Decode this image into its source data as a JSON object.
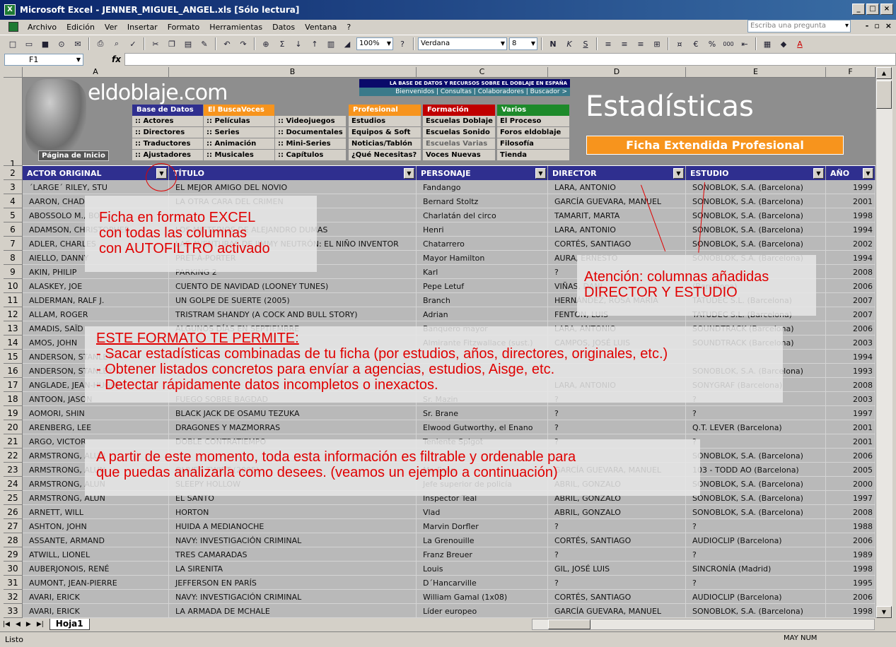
{
  "window": {
    "title": "Microsoft Excel - JENNER_MIGUEL_ANGEL.xls  [Sólo lectura]"
  },
  "menu": [
    "Archivo",
    "Edición",
    "Ver",
    "Insertar",
    "Formato",
    "Herramientas",
    "Datos",
    "Ventana",
    "?"
  ],
  "ask_placeholder": "Escriba una pregunta",
  "toolbar": {
    "zoom": "100%",
    "font": "Verdana",
    "size": "8"
  },
  "formula": {
    "namebox": "F1",
    "fx": "fx"
  },
  "columns": [
    "A",
    "B",
    "C",
    "D",
    "E",
    "F"
  ],
  "banner": {
    "logo": "eldoblaje.com",
    "tagline": "LA BASE DE DATOS Y RECURSOS SOBRE EL DOBLAJE EN ESPAÑA",
    "topnav": "Bienvenidos | Consultas | Colaboradores | Buscador >",
    "home": "Página de Inicio",
    "estadisticas": "Estadísticas",
    "ficha": "Ficha Extendida Profesional",
    "nav": [
      {
        "header": "Base de Datos",
        "color": "#2f2f8f",
        "items": [
          ":: Actores",
          ":: Directores",
          ":: Traductores",
          ":: Ajustadores"
        ]
      },
      {
        "header": "El BuscaVoces",
        "color": "#f7941d",
        "items": [
          ":: Películas",
          ":: Series",
          ":: Animación",
          ":: Musicales"
        ]
      },
      {
        "header": "",
        "color": "#8e8e8e",
        "items": [
          ":: Videojuegos",
          ":: Documentales",
          ":: Mini-Series",
          ":: Capítulos"
        ]
      },
      {
        "header": "Profesional",
        "color": "#f7941d",
        "items": [
          "Estudios",
          "Equipos & Soft",
          "Noticias/Tablón",
          "¿Qué Necesitas?"
        ]
      },
      {
        "header": "Formación",
        "color": "#c00000",
        "items": [
          "Escuelas Doblaje",
          "Escuelas Sonido",
          "Escuelas Varias",
          "Voces Nuevas"
        ]
      },
      {
        "header": "Varios",
        "color": "#1d8a2a",
        "items": [
          "El Proceso",
          "Foros eldoblaje",
          "Filosofía",
          "Tienda"
        ]
      }
    ]
  },
  "headers": [
    "ACTOR ORIGINAL",
    "TÍTULO",
    "PERSONAJE",
    "DIRECTOR",
    "ESTUDIO",
    "AÑO"
  ],
  "rows": [
    [
      "´LARGE´ RILEY, STU",
      "EL MEJOR AMIGO DEL NOVIO",
      "Fandango",
      "LARA, ANTONIO",
      "SONOBLOK, S.A. (Barcelona)",
      "1999"
    ],
    [
      "AARON, CHAD",
      "LA OTRA CARA DEL CRIMEN",
      "Bernard Stoltz",
      "GARCÍA GUEVARA, MANUEL",
      "SONOBLOK, S.A. (Barcelona)",
      "2001"
    ],
    [
      "ABOSSOLO M., BO",
      "",
      "Charlatán del circo",
      "TAMARIT, MARTA",
      "SONOBLOK, S.A. (Barcelona)",
      "1998"
    ],
    [
      "ADAMSON, CHRISTOPHER",
      "LOS MISTERIOS DE ALEJANDRO DUMAS",
      "Henri",
      "LARA, ANTONIO",
      "SONOBLOK, S.A. (Barcelona)",
      "1994"
    ],
    [
      "ADLER, CHARLES",
      "LAS AVENTURAS DE JIMMY NEUTRÓN: EL NIÑO INVENTOR",
      "Chatarrero",
      "CORTÉS, SANTIAGO",
      "SONOBLOK, S.A. (Barcelona)",
      "2002"
    ],
    [
      "AIELLO, DANNY",
      "PRÊT-À-PORTER",
      "Mayor Hamilton",
      "AURA, ERNESTO",
      "SONOBLOK, S.A. (Barcelona)",
      "1994"
    ],
    [
      "AKIN, PHILIP",
      "PARKING 2",
      "Karl",
      "?",
      "",
      "2008"
    ],
    [
      "ALASKEY, JOE",
      "CUENTO DE NAVIDAD (LOONEY TUNES)",
      "Pepe Letuf",
      "VIÑAS, DANI",
      "(Barcelona)",
      "2006"
    ],
    [
      "ALDERMAN, RALF J.",
      "UN GOLPE DE SUERTE (2005)",
      "Branch",
      "HERNÁNDEZ, ROSA MARÍA",
      "TATUDEC S.L. (Barcelona)",
      "2007"
    ],
    [
      "ALLAM, ROGER",
      "TRISTRAM SHANDY (A COCK AND BULL STORY)",
      "Adrian",
      "FENTON, LUIS",
      "TATUDEC S.L. (Barcelona)",
      "2007"
    ],
    [
      "AMADIS, SAÏD",
      "ALGUNOS DÍAS EN SEPTIEMBRE",
      "Banquero mayor",
      "LARA, ANTONIO",
      "SOUNDTRACK (Barcelona)",
      "2006"
    ],
    [
      "AMOS, JOHN",
      "",
      "Almirante Fitzwallace (sust.)",
      "CAMPOS, JOSÉ LUIS",
      "SOUNDTRACK (Barcelona)",
      "2003"
    ],
    [
      "ANDERSON, STANLEY",
      "",
      "",
      "",
      "",
      "1994"
    ],
    [
      "ANDERSON, STANLEY",
      "",
      "",
      "",
      "SONOBLOK, S.A. (Barcelona)",
      "1993"
    ],
    [
      "ANGLADE, JEAN-HUGUES",
      "",
      "",
      "LARA, ANTONIO",
      "SONYGRAF (Barcelona)",
      "2008"
    ],
    [
      "ANTOON, JASON",
      "FUEGO SOBRE BAGDAD",
      "Sr. Mazin",
      "?",
      "?",
      "2003"
    ],
    [
      "AOMORI, SHIN",
      "BLACK JACK DE OSAMU TEZUKA",
      "Sr. Brane",
      "?",
      "?",
      "1997"
    ],
    [
      "ARENBERG, LEE",
      "DRAGONES Y MAZMORRAS",
      "Elwood Gutworthy, el Enano",
      "?",
      "Q.T. LEVER (Barcelona)",
      "2001"
    ],
    [
      "ARGO, VICTOR",
      "DOBLE CONTRATIEMPO",
      "Teniente Spigot",
      "?",
      "?",
      "2001"
    ],
    [
      "ARMSTRONG, ALUN",
      "",
      "",
      "",
      "SONOBLOK, S.A. (Barcelona)",
      "2006"
    ],
    [
      "ARMSTRONG, ALUN",
      "OLIVER TWIST (2005)",
      "Mr. Fang",
      "GARCÍA GUEVARA, MANUEL",
      "103 - TODD AO (Barcelona)",
      "2005"
    ],
    [
      "ARMSTRONG, ALUN",
      "SLEEPY HOLLOW",
      "Jefe superior de policía",
      "ABRIL, GONZALO",
      "SONOBLOK, S.A. (Barcelona)",
      "2000"
    ],
    [
      "ARMSTRONG, ALUN",
      "EL SANTO",
      "Inspector Teal",
      "ABRIL, GONZALO",
      "SONOBLOK, S.A. (Barcelona)",
      "1997"
    ],
    [
      "ARNETT, WILL",
      "HORTON",
      "Vlad",
      "ABRIL, GONZALO",
      "SONOBLOK, S.A. (Barcelona)",
      "2008"
    ],
    [
      "ASHTON, JOHN",
      "HUIDA A MEDIANOCHE",
      "Marvin Dorfler",
      "?",
      "?",
      "1988"
    ],
    [
      "ASSANTE, ARMAND",
      "NAVY: INVESTIGACIÓN CRIMINAL",
      "La Grenouille",
      "CORTÉS, SANTIAGO",
      "AUDIOCLIP (Barcelona)",
      "2006"
    ],
    [
      "ATWILL, LIONEL",
      "TRES CAMARADAS",
      "Franz Breuer",
      "?",
      "?",
      "1989"
    ],
    [
      "AUBERJONOIS, RENÉ",
      "LA SIRENITA",
      "Louis",
      "GIL, JOSÉ LUIS",
      "SINCRONÍA (Madrid)",
      "1998"
    ],
    [
      "AUMONT, JEAN-PIERRE",
      "JEFFERSON EN PARÍS",
      "D´Hancarville",
      "?",
      "?",
      "1995"
    ],
    [
      "AVARI, ERICK",
      "NAVY: INVESTIGACIÓN CRIMINAL",
      "William Gamal (1x08)",
      "CORTÉS, SANTIAGO",
      "AUDIOCLIP (Barcelona)",
      "2006"
    ],
    [
      "AVARI, ERICK",
      "LA ARMADA DE MCHALE",
      "Líder europeo",
      "GARCÍA GUEVARA, MANUEL",
      "SONOBLOK, S.A. (Barcelona)",
      "1998"
    ]
  ],
  "overlays": {
    "o1": [
      "Ficha en formato EXCEL",
      "con todas las columnas",
      "con AUTOFILTRO activado"
    ],
    "o2": [
      "Atención: columnas añadidas",
      "DIRECTOR Y ESTUDIO"
    ],
    "o3": [
      "ESTE FORMATO TE PERMITE:",
      "- Sacar estadísticas combinadas de tu ficha (por estudios, años, directores, originales, etc.)",
      "- Obtener listados concretos para envíar a agencias, estudios, Aisge, etc.",
      "- Detectar rápidamente datos incompletos o inexactos."
    ],
    "o4": [
      "A partir de este momento, toda esta información es filtrable y ordenable para",
      "que puedas analizarla como desees. (veamos un ejemplo a continuación)"
    ]
  },
  "sheet_tab": "Hoja1",
  "status": {
    "left": "Listo",
    "right": "MAY NUM"
  }
}
